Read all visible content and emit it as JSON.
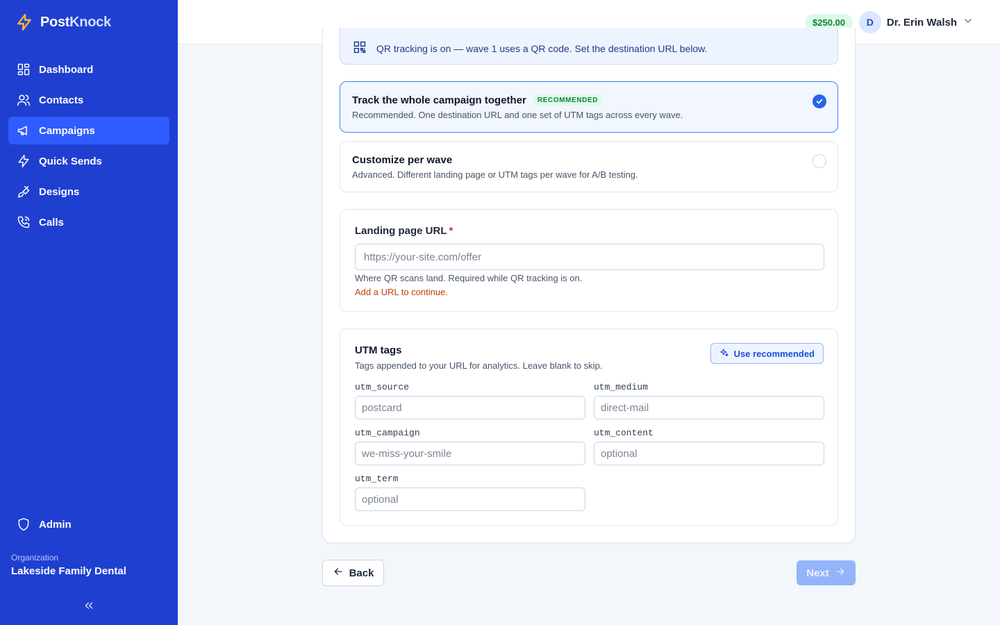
{
  "brand": {
    "name_part1": "Post",
    "name_part2": "Knock",
    "logo_icon": "lightning-bolt-icon"
  },
  "sidebar": {
    "items": [
      {
        "label": "Dashboard",
        "icon": "grid-icon",
        "active": false
      },
      {
        "label": "Contacts",
        "icon": "users-icon",
        "active": false
      },
      {
        "label": "Campaigns",
        "icon": "megaphone-icon",
        "active": true
      },
      {
        "label": "Quick Sends",
        "icon": "lightning-icon",
        "active": false
      },
      {
        "label": "Designs",
        "icon": "paintbrush-icon",
        "active": false
      },
      {
        "label": "Calls",
        "icon": "phone-icon",
        "active": false
      }
    ],
    "admin_label": "Admin",
    "org_label": "Organization",
    "org_name": "Lakeside Family Dental",
    "collapse_icon": "chevrons-left-icon"
  },
  "topbar": {
    "balance": "$250.00",
    "user_initial": "D",
    "user_name": "Dr. Erin Walsh"
  },
  "main": {
    "qr_banner": "QR tracking is on — wave 1 uses a QR code. Set the destination URL below.",
    "options": [
      {
        "title": "Track the whole campaign together",
        "badge": "RECOMMENDED",
        "description": "Recommended. One destination URL and one set of UTM tags across every wave.",
        "selected": true
      },
      {
        "title": "Customize per wave",
        "badge": "",
        "description": "Advanced. Different landing page or UTM tags per wave for A/B testing.",
        "selected": false
      }
    ],
    "landing": {
      "label": "Landing page URL",
      "required_mark": "*",
      "value": "",
      "placeholder": "https://your-site.com/offer",
      "help": "Where QR scans land. Required while QR tracking is on.",
      "warning": "Add a URL to continue."
    },
    "utm": {
      "title": "UTM tags",
      "subtitle": "Tags appended to your URL for analytics. Leave blank to skip.",
      "use_recommended": "Use recommended",
      "fields": {
        "source": {
          "label": "utm_source",
          "value": "",
          "placeholder": "postcard"
        },
        "medium": {
          "label": "utm_medium",
          "value": "",
          "placeholder": "direct-mail"
        },
        "campaign": {
          "label": "utm_campaign",
          "value": "",
          "placeholder": "we-miss-your-smile"
        },
        "content": {
          "label": "utm_content",
          "value": "",
          "placeholder": "optional"
        },
        "term": {
          "label": "utm_term",
          "value": "",
          "placeholder": "optional"
        }
      }
    }
  },
  "footer": {
    "back_label": "Back",
    "next_label": "Next",
    "next_disabled": true
  },
  "colors": {
    "sidebar": "#1f3fd1",
    "active_nav": "#2f5bff",
    "accent": "#2563eb",
    "balance_bg": "#dcfce7",
    "warning": "#c2410c"
  }
}
